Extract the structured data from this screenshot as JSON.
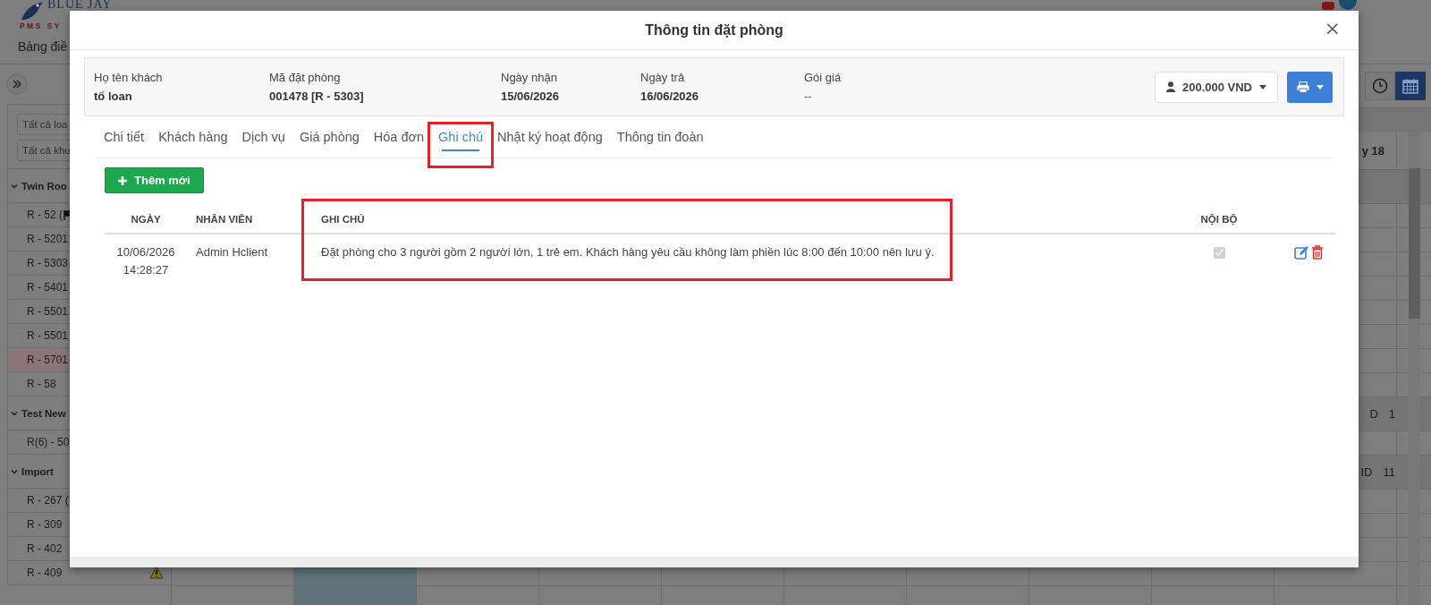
{
  "app": {
    "logo": {
      "name": "BLUE JAY",
      "tagline": "PMS SY"
    },
    "nav_item": "Bảng điề"
  },
  "sidebar": {
    "filters": [
      {
        "placeholder": "Tất cả loa"
      },
      {
        "placeholder": "Tất cả khu"
      }
    ],
    "groups": [
      {
        "name": "Twin Roo",
        "expanded": true,
        "children": [
          {
            "name": "R - 52 (",
            "selected": false,
            "kind": "flagged"
          },
          {
            "name": "R - 5201",
            "selected": false,
            "kind": "plain"
          },
          {
            "name": "R - 5303",
            "selected": false,
            "kind": "plain"
          },
          {
            "name": "R - 5401",
            "selected": false,
            "kind": "plain"
          },
          {
            "name": "R - 5501",
            "selected": false,
            "kind": "plain"
          },
          {
            "name": "R - 5501",
            "selected": false,
            "kind": "plain"
          },
          {
            "name": "R - 5701",
            "selected": true,
            "kind": "plain"
          },
          {
            "name": "R - 58",
            "selected": false,
            "kind": "plain"
          }
        ]
      },
      {
        "name": "Test New",
        "expanded": true,
        "children": [
          {
            "name": "R(6) - 50",
            "selected": false,
            "kind": "plain"
          }
        ]
      },
      {
        "name": "Import",
        "expanded": true,
        "children": [
          {
            "name": "R - 267 (",
            "selected": false,
            "kind": "plain"
          },
          {
            "name": "R - 309",
            "selected": false,
            "kind": "plain"
          },
          {
            "name": "R - 402",
            "selected": false,
            "kind": "plain"
          },
          {
            "name": "R - 409",
            "selected": false,
            "kind": "alert"
          }
        ]
      }
    ]
  },
  "grid": {
    "date_header": "y 18",
    "group_totals": [
      [
        "D",
        "1"
      ],
      [
        "ID",
        "11"
      ]
    ]
  },
  "modal": {
    "title": "Thông tin đặt phòng",
    "close": "×",
    "booking_info": [
      {
        "label": "Họ tên khách",
        "value": "tố loan"
      },
      {
        "label": "Mã đặt phòng",
        "value": "001478 [R - 5303]"
      },
      {
        "label": "Ngày nhận",
        "value": "15/06/2026"
      },
      {
        "label": "Ngày trả",
        "value": "16/06/2026"
      },
      {
        "label": "Gói giá",
        "value": "--"
      }
    ],
    "price_button": "200.000 VND",
    "tabs": [
      {
        "label": "Chi tiết",
        "selected": false
      },
      {
        "label": "Khách hàng",
        "selected": false
      },
      {
        "label": "Dịch vụ",
        "selected": false
      },
      {
        "label": "Giá phòng",
        "selected": false
      },
      {
        "label": "Hóa đơn",
        "selected": false
      },
      {
        "label": "Ghi chú",
        "selected": true
      },
      {
        "label": "Nhật ký hoạt động",
        "selected": false
      },
      {
        "label": "Thông tin đoàn",
        "selected": false
      }
    ],
    "add_button": "Thêm mới",
    "notes_table": {
      "columns": [
        "NGÀY",
        "NHÂN VIÊN",
        "GHI CHÚ",
        "NỘI BỘ"
      ],
      "rows": [
        {
          "date": "10/06/2026",
          "time": "14:28:27",
          "staff": "Admin Hclient",
          "note": "Đặt phòng cho 3 người gồm 2 người lớn, 1 trẻ em. Khách hàng yêu cầu không làm phiền lúc 8:00 đến 10:00 nên lưu ý.",
          "internal": true
        }
      ]
    }
  }
}
